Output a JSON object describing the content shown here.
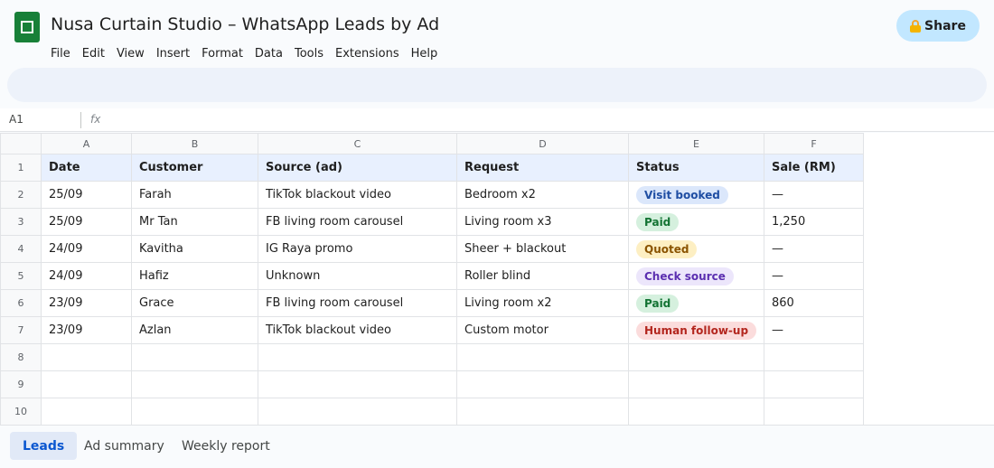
{
  "app": {
    "title": "Nusa Curtain Studio – WhatsApp Leads by Ad",
    "share_label": "Share",
    "icon": "sheets-logo-icon"
  },
  "menu": [
    "File",
    "Edit",
    "View",
    "Insert",
    "Format",
    "Data",
    "Tools",
    "Extensions",
    "Help"
  ],
  "formula_bar": {
    "cell_ref": "A1",
    "fx_label": "fx",
    "value": ""
  },
  "grid": {
    "columns": [
      "A",
      "B",
      "C",
      "D",
      "E",
      "F"
    ],
    "row_numbers": [
      "1",
      "2",
      "3",
      "4",
      "5",
      "6",
      "7",
      "8",
      "9",
      "10"
    ],
    "header": [
      "Date",
      "Customer",
      "Source (ad)",
      "Request",
      "Status",
      "Sale (RM)"
    ],
    "rows": [
      [
        "25/09",
        "Farah",
        "TikTok blackout video",
        "Bedroom x2",
        "Visit booked",
        "—"
      ],
      [
        "25/09",
        "Mr Tan",
        "FB living room carousel",
        "Living room x3",
        "Paid",
        "1,250"
      ],
      [
        "24/09",
        "Kavitha",
        "IG Raya promo",
        "Sheer + blackout",
        "Quoted",
        "—"
      ],
      [
        "24/09",
        "Hafiz",
        "Unknown",
        "Roller blind",
        "Check source",
        "—"
      ],
      [
        "23/09",
        "Grace",
        "FB living room carousel",
        "Living room x2",
        "Paid",
        "860"
      ],
      [
        "23/09",
        "Azlan",
        "TikTok blackout video",
        "Custom motor",
        "Human follow-up",
        "—"
      ]
    ],
    "empty_rows": 3
  },
  "status_colors": {
    "Visit booked": {
      "bg": "#dbe7fb",
      "fg": "#1f4ea3"
    },
    "Paid": {
      "bg": "#d5f0de",
      "fg": "#137333"
    },
    "Quoted": {
      "bg": "#fdefc3",
      "fg": "#8a5300"
    },
    "Check source": {
      "bg": "#ece6fb",
      "fg": "#5b2fb0"
    },
    "Human follow-up": {
      "bg": "#fbdcdc",
      "fg": "#b3261e"
    }
  },
  "sheet_tabs": [
    {
      "label": "Leads",
      "active": true
    },
    {
      "label": "Ad summary",
      "active": false
    },
    {
      "label": "Weekly report",
      "active": false
    }
  ]
}
